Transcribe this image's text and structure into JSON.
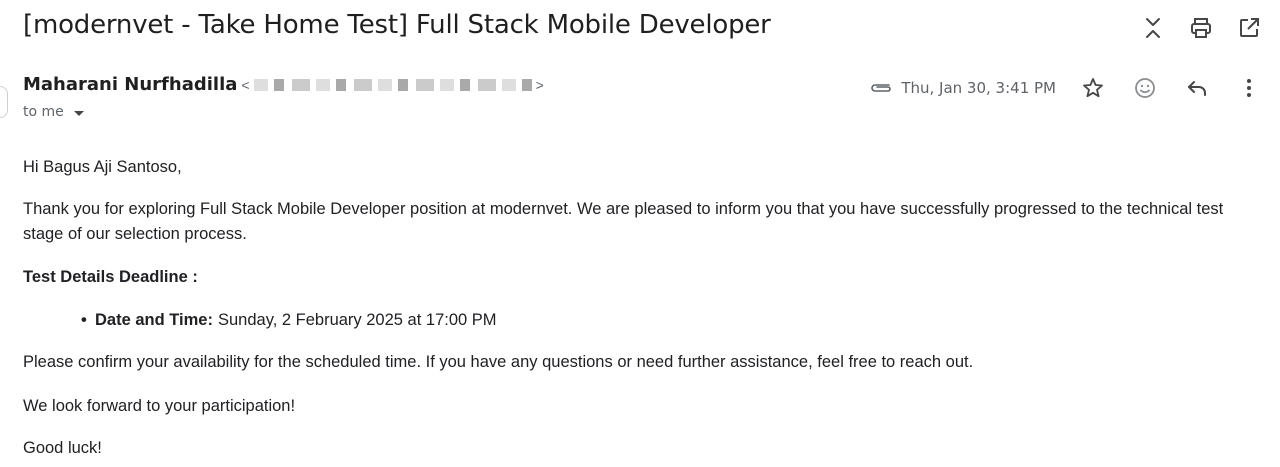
{
  "email": {
    "subject": "[modernvet - Take Home Test] Full Stack Mobile Developer",
    "sender_name": "Maharani Nurfhadilla",
    "sender_email_open": "<",
    "sender_email_close": ">",
    "recipient_label": "to me",
    "date": "Thu, Jan 30, 3:41 PM"
  },
  "body": {
    "greeting": "Hi Bagus Aji Santoso,",
    "thanks": "Thank you for exploring Full Stack Mobile Developer position at modernvet. We are pleased to inform you that you have successfully progressed to the technical test stage of our selection process.",
    "deadline_heading": "Test Details Deadline :",
    "bullet_label": "Date and Time:",
    "bullet_value": "Sunday, 2 February 2025 at 17:00 PM",
    "confirm": "Please confirm your availability for the scheduled time. If you have any questions or need further assistance, feel free to reach out.",
    "forward": "We look forward to your participation!",
    "luck": "Good luck!"
  },
  "icons": {
    "toolbar": [
      "collapse-all-icon",
      "print-icon",
      "open-new-window-icon"
    ],
    "message": [
      "attachment-icon",
      "star-icon",
      "emoji-react-icon",
      "reply-icon",
      "more-options-icon"
    ]
  },
  "colors": {
    "text_primary": "#1f1f1f",
    "text_secondary": "#5f6368",
    "icon": "#444746"
  }
}
